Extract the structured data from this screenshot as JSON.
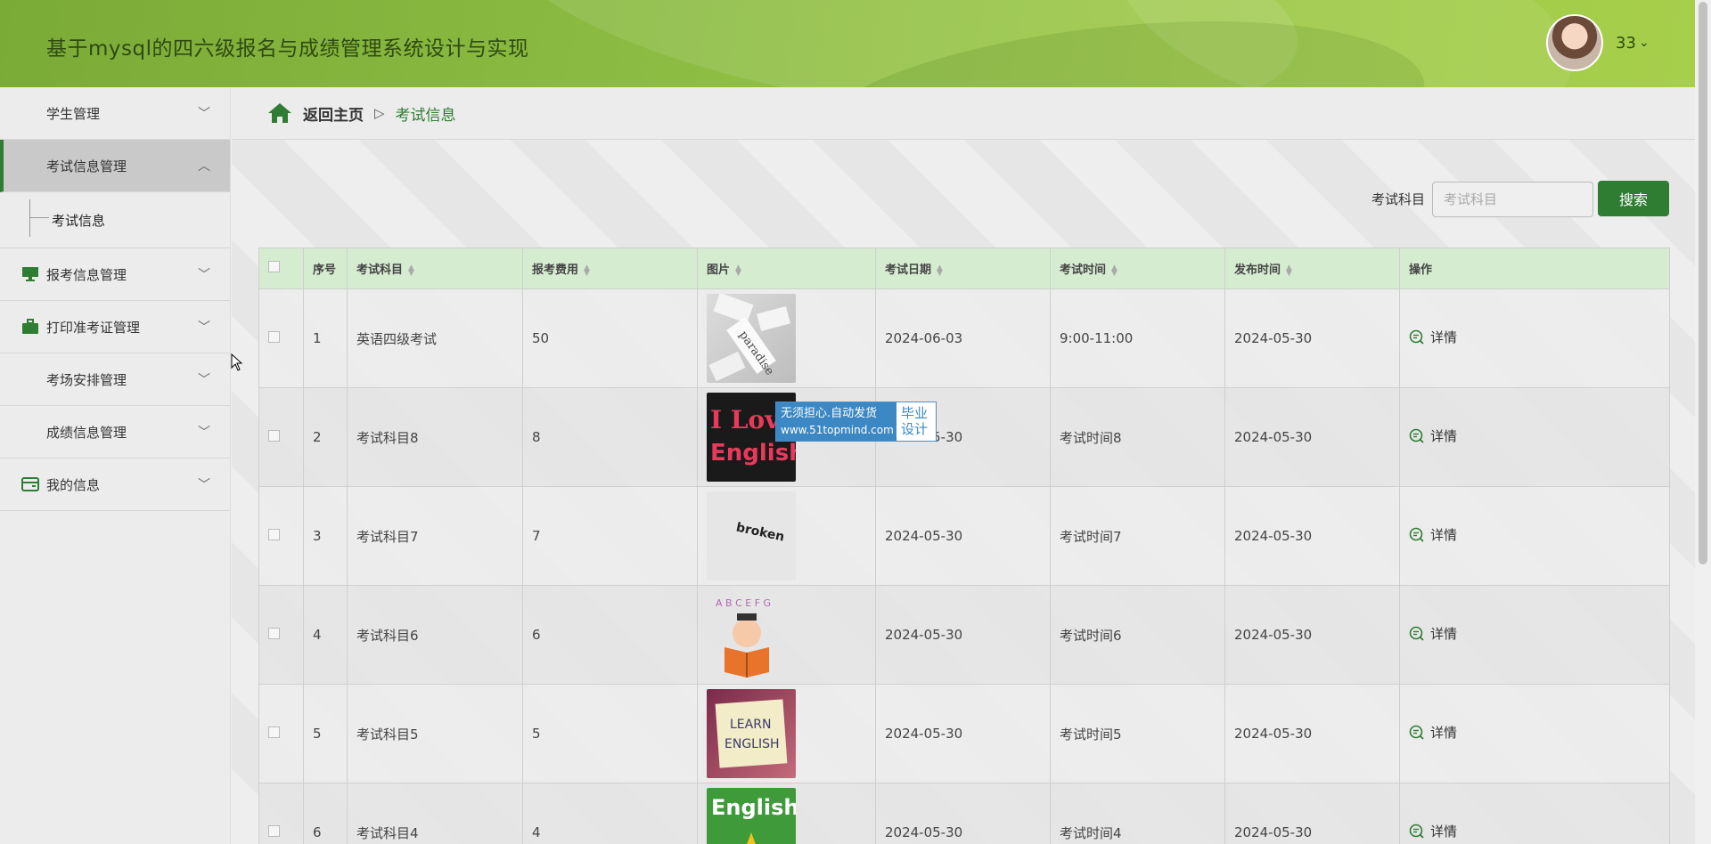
{
  "header": {
    "app_title": "基于mysql的四六级报名与成绩管理系统设计与实现",
    "user_name": "33",
    "user_caret": "⌄",
    "accent_color": "#2e7d32",
    "header_gradient": [
      "#7bab37",
      "#a7cf4c"
    ]
  },
  "sidebar": {
    "items": [
      {
        "label": "学生管理",
        "icon": "grid-icon",
        "expanded": false
      },
      {
        "label": "考试信息管理",
        "icon": "grid-icon",
        "expanded": true,
        "children": [
          {
            "label": "考试信息"
          }
        ]
      },
      {
        "label": "报考信息管理",
        "icon": "monitor-icon",
        "expanded": false
      },
      {
        "label": "打印准考证管理",
        "icon": "briefcase-icon",
        "expanded": false
      },
      {
        "label": "考场安排管理",
        "icon": "grid-icon",
        "expanded": false
      },
      {
        "label": "成绩信息管理",
        "icon": "grid-icon",
        "expanded": false
      },
      {
        "label": "我的信息",
        "icon": "card-icon",
        "expanded": false
      }
    ]
  },
  "breadcrumb": {
    "home": "返回主页",
    "separator": "▷",
    "current": "考试信息"
  },
  "search": {
    "label": "考试科目",
    "placeholder": "考试科目",
    "value": "",
    "button": "搜索"
  },
  "table": {
    "columns": [
      "序号",
      "考试科目",
      "报考费用",
      "图片",
      "考试日期",
      "考试时间",
      "发布时间",
      "操作"
    ],
    "rows": [
      {
        "index": "1",
        "subject": "英语四级考试",
        "fee": "50",
        "image": "paradise-words-photo",
        "date": "2024-06-03",
        "time": "9:00-11:00",
        "published": "2024-05-30",
        "action": "详情"
      },
      {
        "index": "2",
        "subject": "考试科目8",
        "fee": "8",
        "image": "i-love-english-image",
        "date": "2024-05-30",
        "time": "考试时间8",
        "published": "2024-05-30",
        "action": "详情"
      },
      {
        "index": "3",
        "subject": "考试科目7",
        "fee": "7",
        "image": "broken-text-image",
        "date": "2024-05-30",
        "time": "考试时间7",
        "published": "2024-05-30",
        "action": "详情"
      },
      {
        "index": "4",
        "subject": "考试科目6",
        "fee": "6",
        "image": "cartoon-boy-reading-image",
        "date": "2024-05-30",
        "time": "考试时间6",
        "published": "2024-05-30",
        "action": "详情"
      },
      {
        "index": "5",
        "subject": "考试科目5",
        "fee": "5",
        "image": "learn-english-note-image",
        "date": "2024-05-30",
        "time": "考试时间5",
        "published": "2024-05-30",
        "action": "详情"
      },
      {
        "index": "6",
        "subject": "考试科目4",
        "fee": "4",
        "image": "english-green-image",
        "date": "2024-05-30",
        "time": "考试时间4",
        "published": "2024-05-30",
        "action": "详情"
      }
    ]
  },
  "watermark": {
    "line1": "无须担心.自动发货",
    "line2": "www.51topmind.com",
    "side1": "毕业",
    "side2": "设计"
  },
  "thumb_texts": {
    "t1": "paradise",
    "t2a": "I Love",
    "t2b": "English",
    "t3": "broken",
    "t4": "A B C E F G",
    "t5a": "LEARN",
    "t5b": "ENGLISH",
    "t6": "English"
  }
}
